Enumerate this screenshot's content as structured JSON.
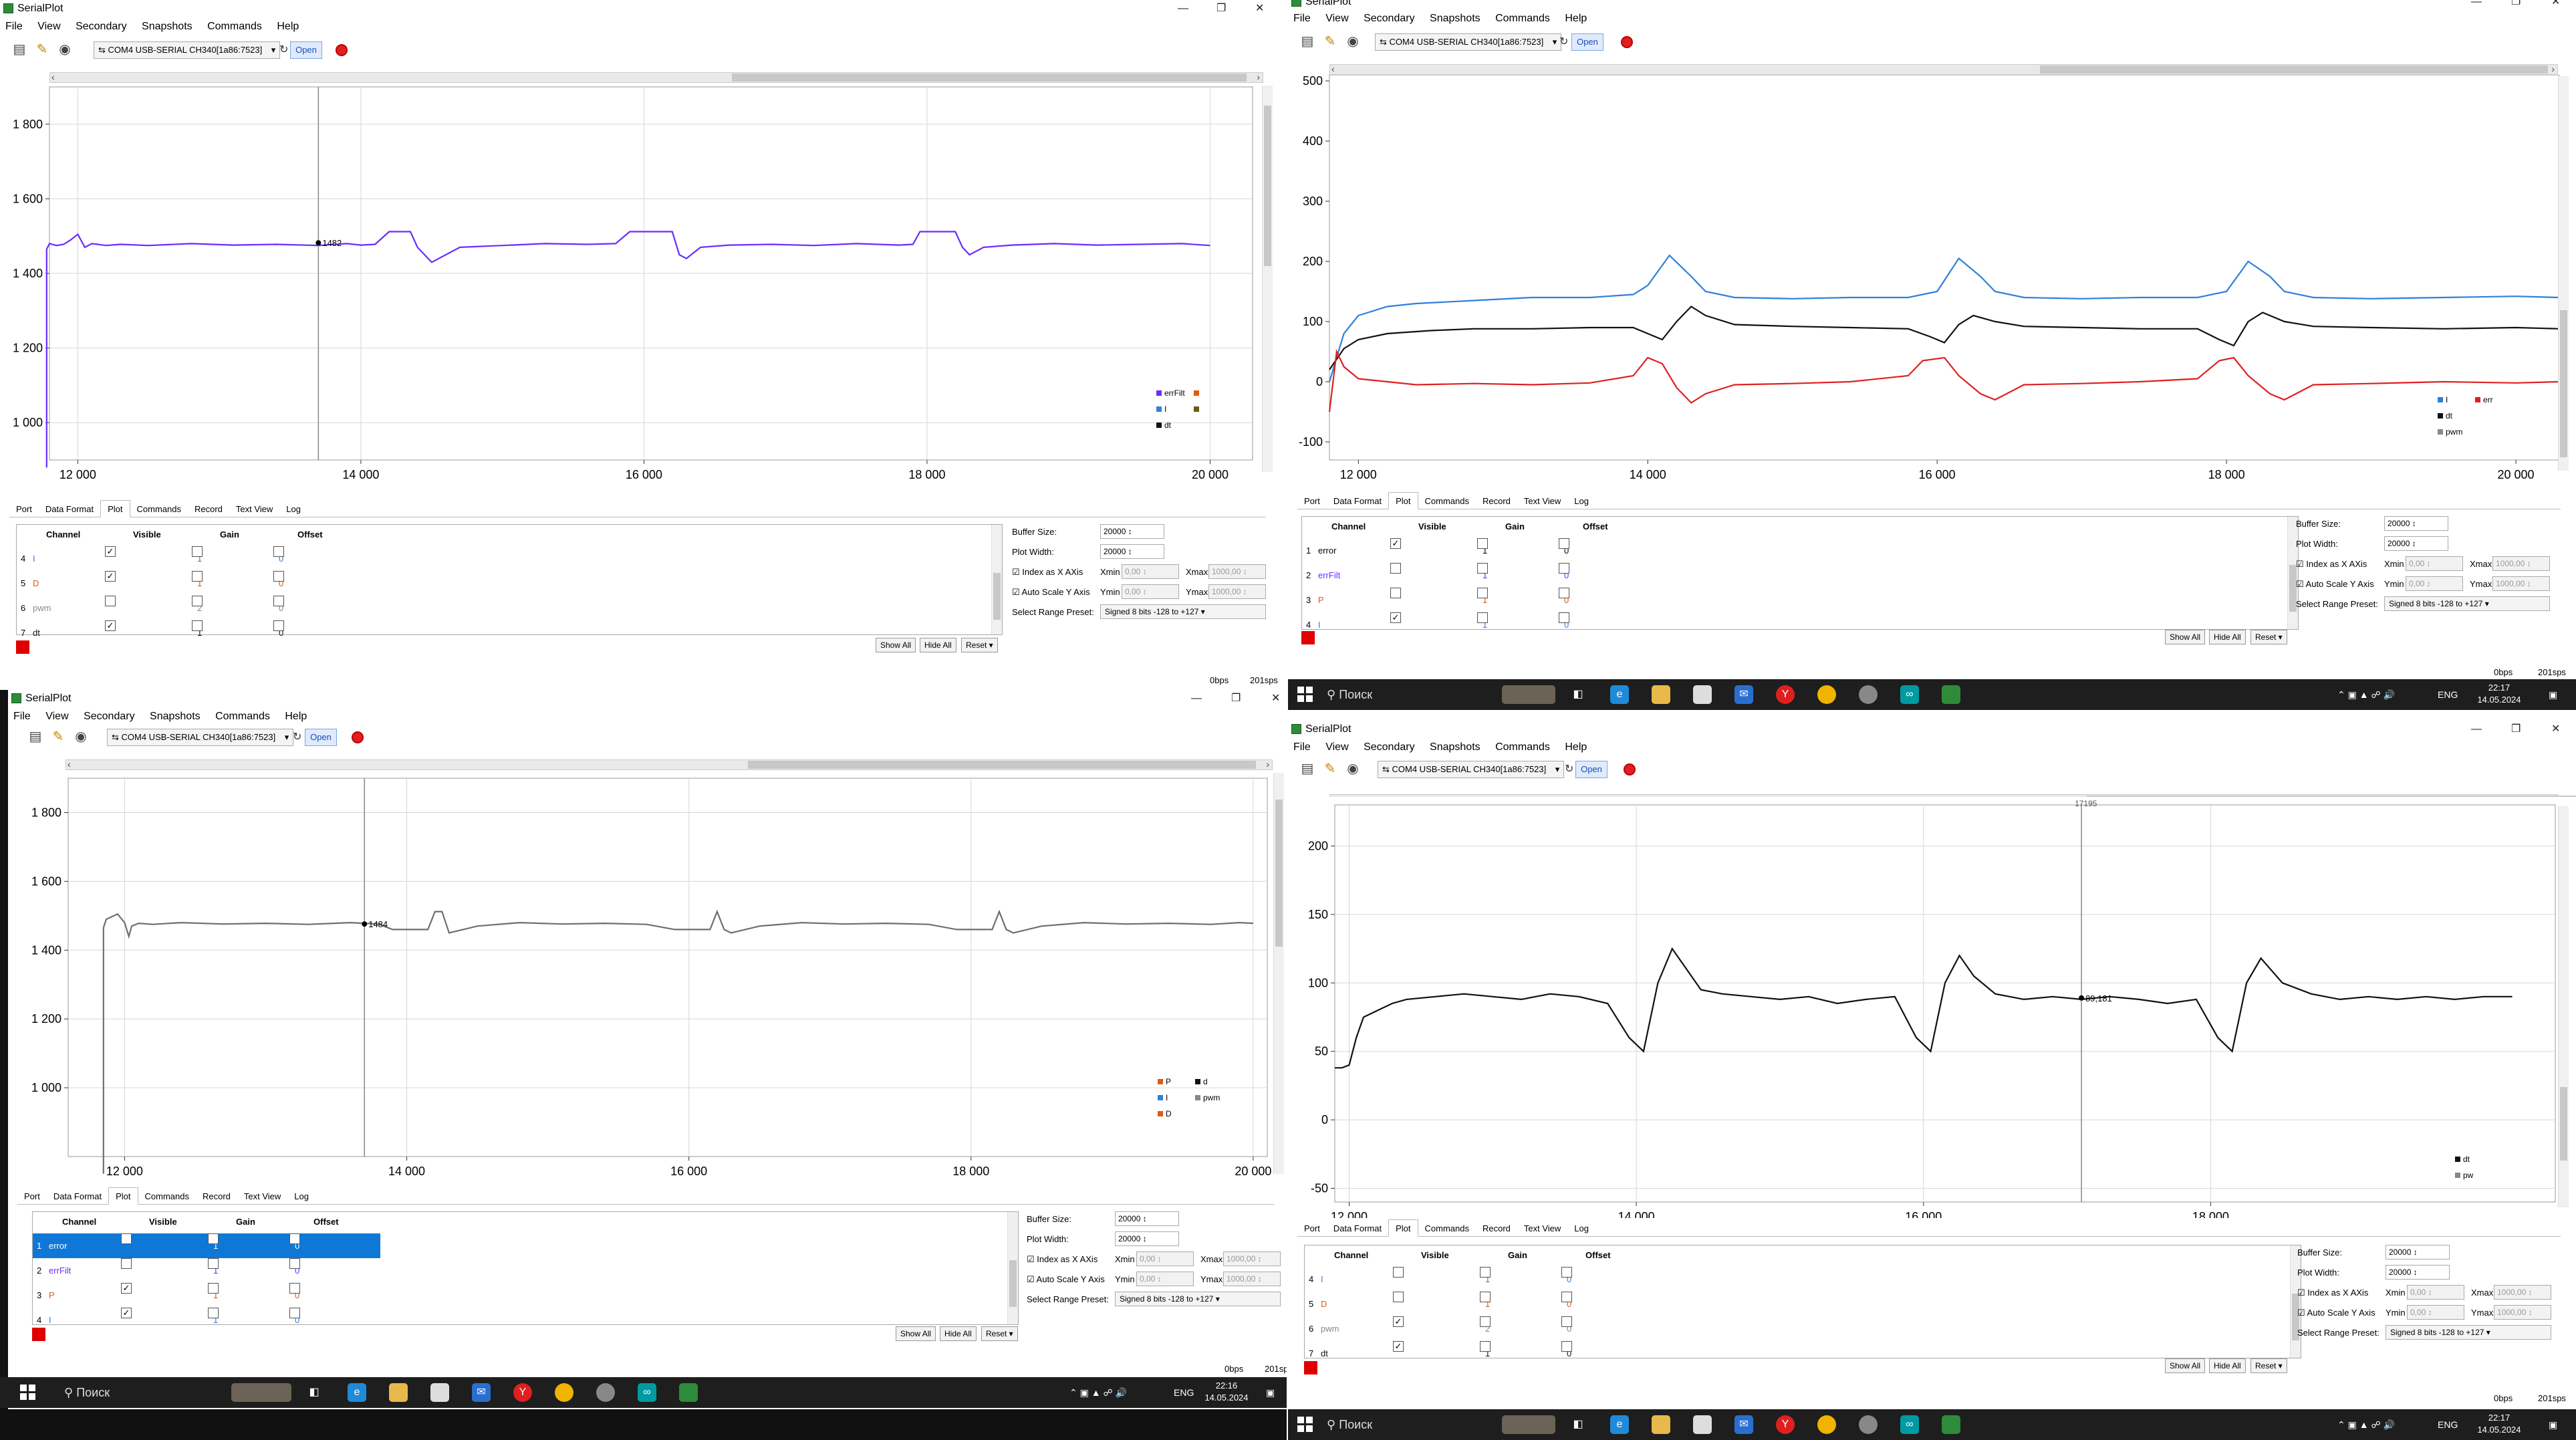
{
  "app": {
    "title": "SerialPlot",
    "menu": [
      "File",
      "View",
      "Secondary",
      "Snapshots",
      "Commands",
      "Help"
    ],
    "port_combo": "⇆ COM4 USB-SERIAL CH340[1a86:7523]",
    "open_label": "Open",
    "tabs": [
      "Port",
      "Data Format",
      "Plot",
      "Commands",
      "Record",
      "Text View",
      "Log"
    ],
    "active_tab": "Plot",
    "table_headers": [
      "Channel",
      "Visible",
      "Gain",
      "Offset"
    ],
    "settings": {
      "buffer_size_label": "Buffer Size:",
      "buffer_size": "20000",
      "plot_width_label": "Plot Width:",
      "plot_width": "20000",
      "index_as_x_label": "Index as X AXis",
      "xmin_label": "Xmin",
      "xmin": "0,00",
      "xmax_label": "Xmax",
      "xmax": "1000,00",
      "auto_scale_label": "Auto Scale Y Axis",
      "ymin_label": "Ymin",
      "ymin": "0,00",
      "ymax_label": "Ymax",
      "ymax": "1000,00",
      "range_preset_label": "Select Range Preset:",
      "range_preset": "Signed 8 bits -128 to +127"
    },
    "buttons": {
      "show_all": "Show All",
      "hide_all": "Hide All",
      "reset": "Reset ▾"
    },
    "status": {
      "bps": "0bps",
      "sps": "201sps"
    },
    "colors": {
      "purple_line": "#6a2cff",
      "blue_line": "#2f7fdc",
      "black_line": "#111111",
      "red_line": "#e02020",
      "grid": "#d7d7d7",
      "selected_row": "#0f78d7",
      "open_button": "#dfeafc"
    }
  },
  "taskbar": {
    "search": "Поиск",
    "lang": "ENG",
    "date": "14.05.2024",
    "time_a": "22:17",
    "time_b": "22:16",
    "icons": [
      "edge-icon",
      "file-explorer-icon",
      "store-icon",
      "mail-icon",
      "yandex-icon",
      "chrome-icon",
      "app-icon",
      "arduino-icon",
      "serialplot-icon"
    ]
  },
  "windows": [
    {
      "id": "q1",
      "x_ticks": [
        "12 000",
        "14 000",
        "16 000",
        "18 000",
        "20 000"
      ],
      "y_ticks": [
        "1 800",
        "1 600",
        "1 400",
        "1 200",
        "1 000"
      ],
      "marker_label": "1482",
      "legend": [
        {
          "name": "errFilt",
          "color": "#6a2cff"
        },
        {
          "name": "I",
          "color": "#2f7fdc"
        },
        {
          "name": "dt",
          "color": "#111111"
        },
        {
          "name": "",
          "color": "#e05a10"
        },
        {
          "name": "",
          "color": "#6b5a10"
        }
      ],
      "channels": [
        {
          "num": "4",
          "name": "I",
          "visible": true,
          "gain": "1",
          "offset": "0",
          "color": "#2f7fdc"
        },
        {
          "num": "5",
          "name": "D",
          "visible": true,
          "gain": "1",
          "offset": "0",
          "color": "#e05a10"
        },
        {
          "num": "6",
          "name": "pwm",
          "visible": false,
          "gain": "2",
          "offset": "0",
          "color": "#888888"
        },
        {
          "num": "7",
          "name": "dt",
          "visible": true,
          "gain": "1",
          "offset": "0",
          "color": "#111111"
        }
      ]
    },
    {
      "id": "q2",
      "x_ticks": [
        "12 000",
        "14 000",
        "16 000",
        "18 000",
        "20 000"
      ],
      "y_ticks": [
        "500",
        "400",
        "300",
        "200",
        "100",
        "0",
        "-100"
      ],
      "legend": [
        {
          "name": "I",
          "color": "#2f7fdc"
        },
        {
          "name": "dt",
          "color": "#111111"
        },
        {
          "name": "pwm",
          "color": "#888888"
        },
        {
          "name": "err",
          "color": "#e02020"
        }
      ],
      "channels": [
        {
          "num": "1",
          "name": "error",
          "visible": true,
          "gain": "1",
          "offset": "0",
          "color": "#000000"
        },
        {
          "num": "2",
          "name": "errFilt",
          "visible": false,
          "gain": "1",
          "offset": "0",
          "color": "#6a2cff"
        },
        {
          "num": "3",
          "name": "P",
          "visible": false,
          "gain": "1",
          "offset": "0",
          "color": "#e05a10"
        },
        {
          "num": "4",
          "name": "I",
          "visible": true,
          "gain": "1",
          "offset": "0",
          "color": "#2f7fdc"
        }
      ]
    },
    {
      "id": "q3",
      "x_ticks": [
        "12 000",
        "14 000",
        "16 000",
        "18 000",
        "20 000"
      ],
      "y_ticks": [
        "1 800",
        "1 600",
        "1 400",
        "1 200",
        "1 000"
      ],
      "marker_label": "1484",
      "legend": [
        {
          "name": "P",
          "color": "#e05a10"
        },
        {
          "name": "I",
          "color": "#2f7fdc"
        },
        {
          "name": "D",
          "color": "#e05a10"
        },
        {
          "name": "d",
          "color": "#111111"
        },
        {
          "name": "pwm",
          "color": "#888888"
        }
      ],
      "channels": [
        {
          "num": "1",
          "name": "error",
          "visible": false,
          "gain": "1",
          "offset": "0",
          "color": "#ffffff",
          "selected": true
        },
        {
          "num": "2",
          "name": "errFilt",
          "visible": false,
          "gain": "1",
          "offset": "0",
          "color": "#6a2cff"
        },
        {
          "num": "3",
          "name": "P",
          "visible": true,
          "gain": "1",
          "offset": "0",
          "color": "#e05a10"
        },
        {
          "num": "4",
          "name": "I",
          "visible": true,
          "gain": "1",
          "offset": "0",
          "color": "#2f7fdc"
        }
      ]
    },
    {
      "id": "q4",
      "x_ticks": [
        "12 000",
        "14 000",
        "16 000",
        "18 000"
      ],
      "y_ticks": [
        "200",
        "150",
        "100",
        "50",
        "0",
        "-50"
      ],
      "marker_label": "89,181",
      "top_label": "17195",
      "legend": [
        {
          "name": "dt",
          "color": "#111111"
        },
        {
          "name": "pw",
          "color": "#888888"
        }
      ],
      "channels": [
        {
          "num": "4",
          "name": "I",
          "visible": false,
          "gain": "1",
          "offset": "0",
          "color": "#2f7fdc"
        },
        {
          "num": "5",
          "name": "D",
          "visible": false,
          "gain": "1",
          "offset": "0",
          "color": "#e05a10"
        },
        {
          "num": "6",
          "name": "pwm",
          "visible": true,
          "gain": "2",
          "offset": "0",
          "color": "#888888"
        },
        {
          "num": "7",
          "name": "dt",
          "visible": true,
          "gain": "1",
          "offset": "0",
          "color": "#111111"
        }
      ]
    }
  ],
  "chart_data": [
    {
      "type": "line",
      "window": "q1",
      "xlim": [
        11800,
        20300
      ],
      "ylim": [
        900,
        1900
      ],
      "grid": true,
      "legend_position": "bottom-right",
      "series": [
        {
          "name": "errFilt",
          "color": "#6a2cff",
          "x": [
            11780,
            11780,
            11800,
            11850,
            11900,
            11950,
            12000,
            12050,
            12100,
            12200,
            12300,
            12500,
            12800,
            13100,
            13400,
            13700,
            13900,
            14000,
            14100,
            14200,
            14300,
            14350,
            14400,
            14500,
            14700,
            15000,
            15300,
            15600,
            15800,
            15900,
            15920,
            16000,
            16100,
            16200,
            16250,
            16300,
            16400,
            16600,
            16900,
            17200,
            17500,
            17800,
            17900,
            17950,
            18000,
            18100,
            18200,
            18250,
            18300,
            18400,
            18600,
            18900,
            19200,
            19500,
            19800,
            20000
          ],
          "y": [
            880,
            1465,
            1480,
            1475,
            1478,
            1490,
            1505,
            1470,
            1480,
            1475,
            1478,
            1475,
            1480,
            1476,
            1478,
            1475,
            1480,
            1476,
            1478,
            1512,
            1512,
            1512,
            1470,
            1430,
            1470,
            1475,
            1480,
            1478,
            1480,
            1512,
            1512,
            1512,
            1512,
            1512,
            1450,
            1440,
            1470,
            1476,
            1478,
            1475,
            1480,
            1476,
            1478,
            1512,
            1512,
            1512,
            1512,
            1470,
            1450,
            1470,
            1476,
            1480,
            1476,
            1478,
            1480,
            1475
          ]
        }
      ]
    },
    {
      "type": "line",
      "window": "q2",
      "xlim": [
        11800,
        20300
      ],
      "ylim": [
        -130,
        510
      ],
      "grid": false,
      "legend_position": "bottom-right",
      "series": [
        {
          "name": "I",
          "color": "#2f7fdc",
          "x": [
            11800,
            11900,
            12000,
            12200,
            12400,
            12800,
            13200,
            13600,
            13900,
            14000,
            14150,
            14300,
            14400,
            14600,
            15000,
            15400,
            15800,
            16000,
            16150,
            16300,
            16400,
            16600,
            17000,
            17400,
            17800,
            18000,
            18150,
            18300,
            18400,
            18600,
            19000,
            19500,
            20000,
            20300
          ],
          "y": [
            0,
            80,
            110,
            125,
            130,
            135,
            140,
            140,
            145,
            160,
            210,
            175,
            150,
            140,
            138,
            140,
            140,
            150,
            205,
            175,
            150,
            140,
            138,
            140,
            140,
            150,
            200,
            175,
            150,
            140,
            138,
            140,
            142,
            140
          ]
        },
        {
          "name": "dt",
          "color": "#111111",
          "x": [
            11800,
            11900,
            12000,
            12200,
            12500,
            12800,
            13200,
            13600,
            13900,
            14000,
            14100,
            14200,
            14300,
            14400,
            14600,
            15000,
            15400,
            15800,
            15950,
            16050,
            16150,
            16250,
            16400,
            16600,
            17000,
            17400,
            17800,
            17950,
            18050,
            18150,
            18250,
            18400,
            18600,
            19000,
            19500,
            20000,
            20300
          ],
          "y": [
            20,
            55,
            70,
            80,
            85,
            88,
            88,
            90,
            90,
            80,
            70,
            100,
            125,
            110,
            95,
            92,
            90,
            88,
            75,
            65,
            95,
            110,
            100,
            92,
            90,
            88,
            88,
            70,
            60,
            100,
            115,
            100,
            92,
            90,
            88,
            90,
            88
          ]
        },
        {
          "name": "err",
          "color": "#e02020",
          "x": [
            11800,
            11850,
            11900,
            12000,
            12200,
            12400,
            12800,
            13200,
            13600,
            13900,
            14000,
            14100,
            14200,
            14300,
            14400,
            14600,
            15000,
            15400,
            15800,
            15900,
            16050,
            16150,
            16300,
            16400,
            16600,
            17000,
            17400,
            17800,
            17950,
            18050,
            18150,
            18300,
            18400,
            18600,
            19000,
            19500,
            20000,
            20300
          ],
          "y": [
            -50,
            50,
            25,
            5,
            0,
            -5,
            -3,
            -5,
            -2,
            10,
            40,
            30,
            -10,
            -35,
            -20,
            -5,
            -3,
            0,
            10,
            35,
            40,
            10,
            -20,
            -30,
            -5,
            -3,
            0,
            5,
            35,
            40,
            10,
            -20,
            -30,
            -5,
            -3,
            0,
            -2,
            0
          ]
        }
      ]
    },
    {
      "type": "line",
      "window": "q3",
      "xlim": [
        11600,
        20100
      ],
      "ylim": [
        800,
        1900
      ],
      "grid": true,
      "legend_position": "bottom-right",
      "series": [
        {
          "name": "",
          "color": "#6f6f6f",
          "x": [
            11850,
            11850,
            11870,
            11950,
            12000,
            12030,
            12050,
            12100,
            12200,
            12400,
            12700,
            13000,
            13300,
            13600,
            13800,
            13900,
            14000,
            14150,
            14200,
            14250,
            14300,
            14500,
            14800,
            15100,
            15400,
            15700,
            15900,
            16000,
            16150,
            16200,
            16250,
            16300,
            16500,
            16800,
            17100,
            17400,
            17700,
            17900,
            18000,
            18150,
            18200,
            18250,
            18300,
            18500,
            18800,
            19100,
            19400,
            19700,
            19900,
            20000
          ],
          "y": [
            750,
            1465,
            1490,
            1505,
            1480,
            1440,
            1470,
            1478,
            1475,
            1480,
            1476,
            1478,
            1475,
            1480,
            1476,
            1460,
            1460,
            1460,
            1512,
            1512,
            1450,
            1470,
            1480,
            1476,
            1478,
            1475,
            1460,
            1460,
            1460,
            1512,
            1460,
            1450,
            1470,
            1480,
            1476,
            1478,
            1475,
            1460,
            1460,
            1460,
            1512,
            1460,
            1450,
            1470,
            1480,
            1476,
            1478,
            1475,
            1480,
            1478
          ]
        }
      ]
    },
    {
      "type": "line",
      "window": "q4",
      "xlim": [
        11900,
        20400
      ],
      "ylim": [
        -60,
        230
      ],
      "grid": true,
      "legend_position": "bottom-right",
      "series": [
        {
          "name": "dt",
          "color": "#111111",
          "x": [
            11900,
            11950,
            12000,
            12050,
            12100,
            12200,
            12300,
            12400,
            12600,
            12800,
            13000,
            13200,
            13400,
            13600,
            13800,
            13950,
            14050,
            14150,
            14250,
            14350,
            14450,
            14600,
            14800,
            15000,
            15200,
            15400,
            15600,
            15800,
            15950,
            16050,
            16150,
            16250,
            16350,
            16500,
            16700,
            16900,
            17100,
            17300,
            17500,
            17700,
            17900,
            18050,
            18150,
            18250,
            18350,
            18500,
            18700,
            18900,
            19100,
            19300,
            19500,
            19700,
            19900,
            20100
          ],
          "y": [
            38,
            38,
            40,
            60,
            75,
            80,
            85,
            88,
            90,
            92,
            90,
            88,
            92,
            90,
            85,
            60,
            50,
            100,
            125,
            110,
            95,
            92,
            90,
            88,
            90,
            85,
            88,
            90,
            60,
            50,
            100,
            120,
            105,
            92,
            88,
            90,
            88,
            90,
            88,
            85,
            88,
            60,
            50,
            100,
            118,
            100,
            92,
            88,
            90,
            88,
            90,
            88,
            90,
            90
          ]
        }
      ]
    }
  ]
}
